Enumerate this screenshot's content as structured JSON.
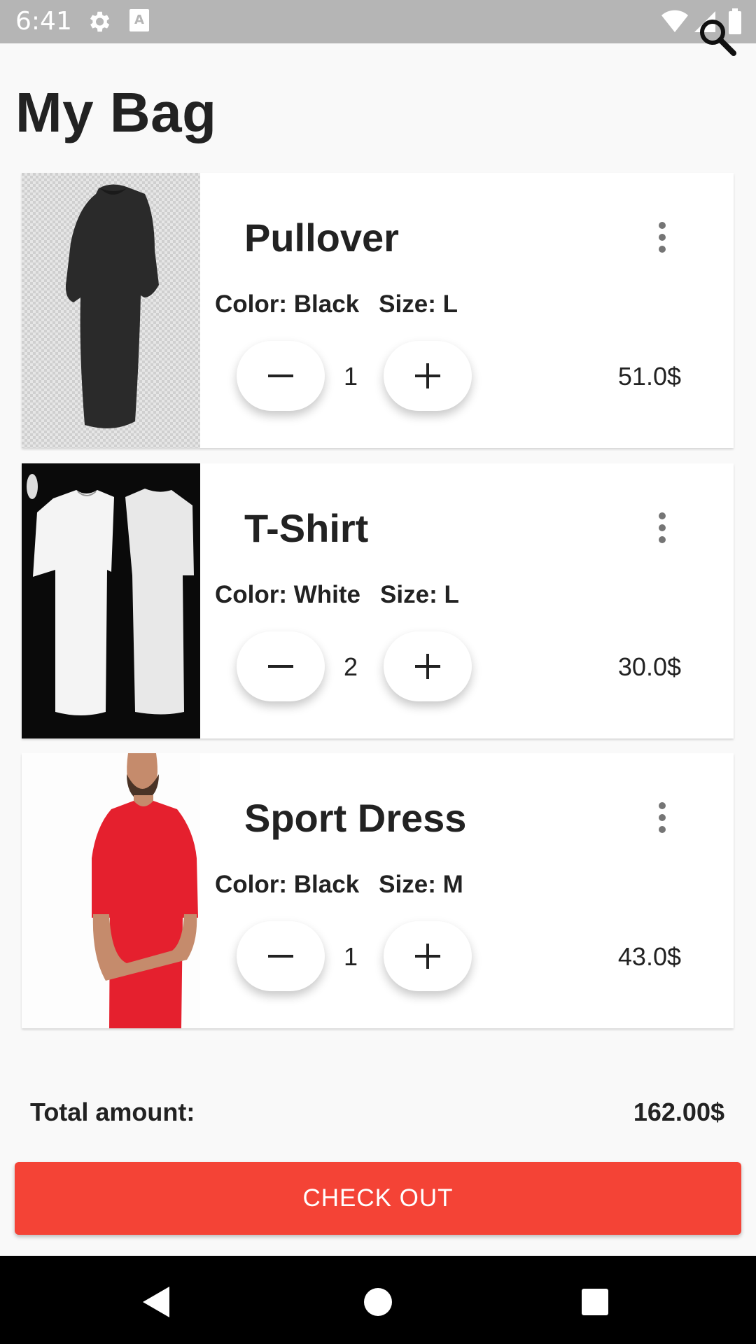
{
  "status_bar": {
    "time": "6:41"
  },
  "page": {
    "title": "My Bag"
  },
  "items": [
    {
      "name": "Pullover",
      "color": "Color: Black",
      "size": "Size: L",
      "quantity": "1",
      "price": "51.0$"
    },
    {
      "name": "T-Shirt",
      "color": "Color: White",
      "size": "Size: L",
      "quantity": "2",
      "price": "30.0$"
    },
    {
      "name": "Sport Dress",
      "color": "Color: Black",
      "size": "Size: M",
      "quantity": "1",
      "price": "43.0$"
    }
  ],
  "summary": {
    "total_label": "Total amount:",
    "total_value": "162.00$"
  },
  "checkout": {
    "label": "CHECK OUT"
  },
  "colors": {
    "accent": "#f44336",
    "status_bar": "#b5b5b5",
    "background": "#f9f9f9"
  },
  "icons": [
    "gear-icon",
    "keyboard-icon",
    "wifi-icon",
    "signal-icon",
    "battery-icon",
    "search-icon",
    "more-vert-icon",
    "minus-icon",
    "plus-icon",
    "back-icon",
    "home-icon",
    "recents-icon"
  ]
}
